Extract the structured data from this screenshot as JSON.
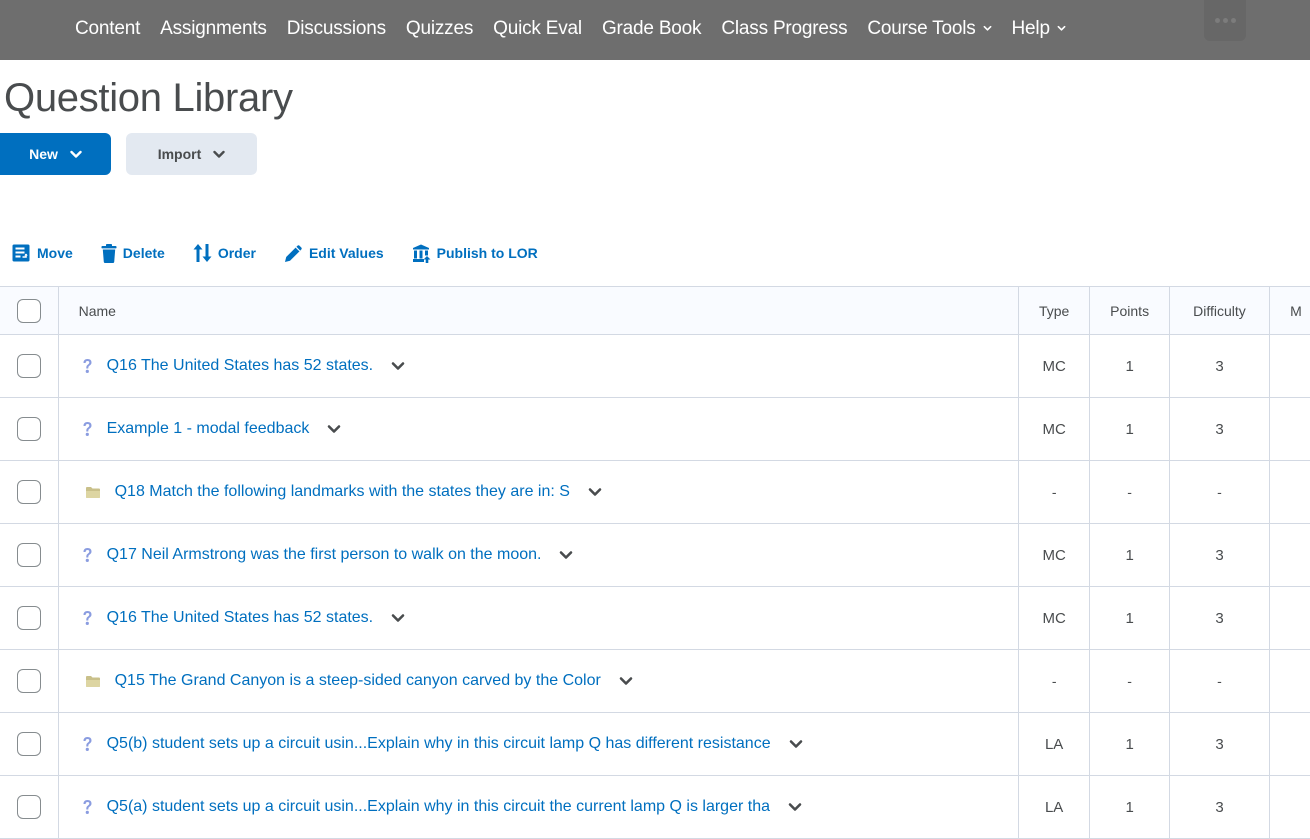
{
  "topnav": {
    "items": [
      {
        "label": "Content",
        "dropdown": false
      },
      {
        "label": "Assignments",
        "dropdown": false
      },
      {
        "label": "Discussions",
        "dropdown": false
      },
      {
        "label": "Quizzes",
        "dropdown": false
      },
      {
        "label": "Quick Eval",
        "dropdown": false
      },
      {
        "label": "Grade Book",
        "dropdown": false
      },
      {
        "label": "Class Progress",
        "dropdown": false
      },
      {
        "label": "Course Tools",
        "dropdown": true
      },
      {
        "label": "Help",
        "dropdown": true
      }
    ],
    "more_icon": "ellipsis-icon"
  },
  "page": {
    "title": "Question Library"
  },
  "buttons": {
    "new_label": "New",
    "import_label": "Import"
  },
  "toolbar": {
    "move_label": "Move",
    "delete_label": "Delete",
    "order_label": "Order",
    "edit_values_label": "Edit Values",
    "publish_label": "Publish to LOR"
  },
  "table": {
    "headers": {
      "name": "Name",
      "type": "Type",
      "points": "Points",
      "difficulty": "Difficulty",
      "more": "M"
    },
    "rows": [
      {
        "icon": "question-icon",
        "name": "Q16 The United States has 52 states.",
        "type": "MC",
        "points": "1",
        "difficulty": "3"
      },
      {
        "icon": "question-icon",
        "name": "Example 1 - modal feedback",
        "type": "MC",
        "points": "1",
        "difficulty": "3"
      },
      {
        "icon": "folder-icon",
        "name": "Q18 Match the following landmarks with the states they are in: S",
        "type": "-",
        "points": "-",
        "difficulty": "-"
      },
      {
        "icon": "question-icon",
        "name": "Q17 Neil Armstrong was the first person to walk on the moon.",
        "type": "MC",
        "points": "1",
        "difficulty": "3"
      },
      {
        "icon": "question-icon",
        "name": "Q16 The United States has 52 states.",
        "type": "MC",
        "points": "1",
        "difficulty": "3"
      },
      {
        "icon": "folder-icon",
        "name": "Q15 The Grand Canyon is a steep-sided canyon carved by the Color",
        "type": "-",
        "points": "-",
        "difficulty": "-"
      },
      {
        "icon": "question-icon",
        "name": "Q5(b) student sets up a circuit usin...Explain why in this circuit lamp Q has different resistance",
        "type": "LA",
        "points": "1",
        "difficulty": "3"
      },
      {
        "icon": "question-icon",
        "name": "Q5(a) student sets up a circuit usin...Explain why in this circuit the current lamp Q is larger tha",
        "type": "LA",
        "points": "1",
        "difficulty": "3"
      }
    ]
  },
  "colors": {
    "nav_bg": "#6e6e6e",
    "primary": "#006fbf",
    "secondary_btn": "#e3e9f1",
    "text": "#494c4e",
    "question_icon": "#8a9ce0",
    "folder_icon": "#c9c08a"
  }
}
